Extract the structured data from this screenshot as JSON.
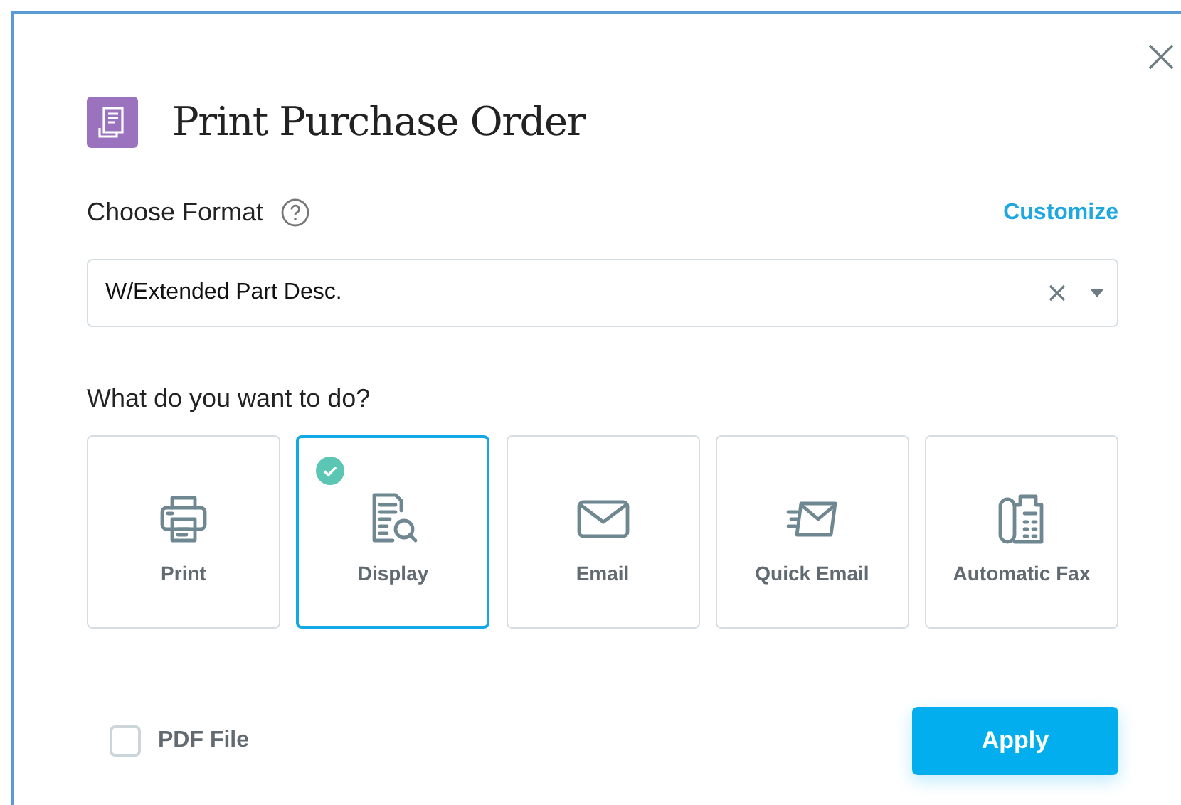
{
  "dialog": {
    "title": "Print Purchase Order"
  },
  "format": {
    "label": "Choose Format",
    "link": "Customize",
    "value": "W/Extended Part Desc."
  },
  "actions": {
    "label": "What do you want to do?",
    "options": [
      {
        "kind": "printer",
        "label": "Print",
        "selected": false
      },
      {
        "kind": "preview",
        "label": "Display",
        "selected": true
      },
      {
        "kind": "envelope",
        "label": "Email",
        "selected": false
      },
      {
        "kind": "fast-envelope",
        "label": "Quick Email",
        "selected": false
      },
      {
        "kind": "fax",
        "label": "Automatic Fax",
        "selected": false
      }
    ]
  },
  "pdf_file": {
    "label": "PDF File",
    "checked": false
  },
  "apply_button": "Apply"
}
